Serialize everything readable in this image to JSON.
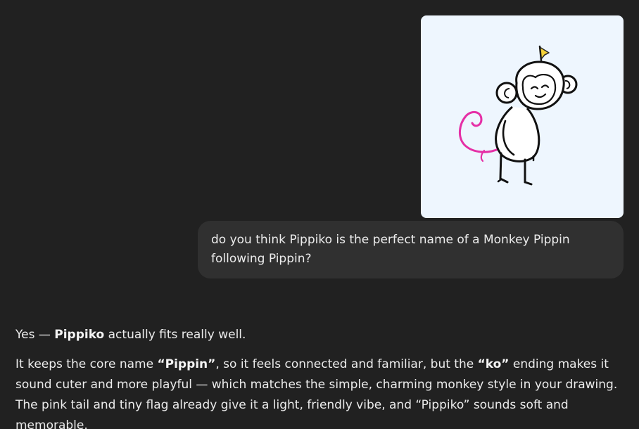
{
  "user_message": {
    "image": {
      "icon": "monkey-drawing",
      "background": "#eef6fe",
      "tail_color": "#e52fa6",
      "flag_color": "#f3d13a"
    },
    "text": "do you think Pippiko is the perfect name of a Monkey Pippin following Pippin?"
  },
  "assistant_message": {
    "p1": {
      "a": "Yes — ",
      "b": "Pippiko",
      "c": " actually fits really well."
    },
    "p2": {
      "a": "It keeps the core name ",
      "b": "“Pippin”",
      "c": ", so it feels connected and familiar, but the ",
      "d": "“ko”",
      "e": " ending makes it sound cuter and more playful — which matches the simple, charming monkey style in your drawing. The pink tail and tiny flag already give it a light, friendly vibe, and “Pippiko” sounds soft and memorable."
    }
  }
}
